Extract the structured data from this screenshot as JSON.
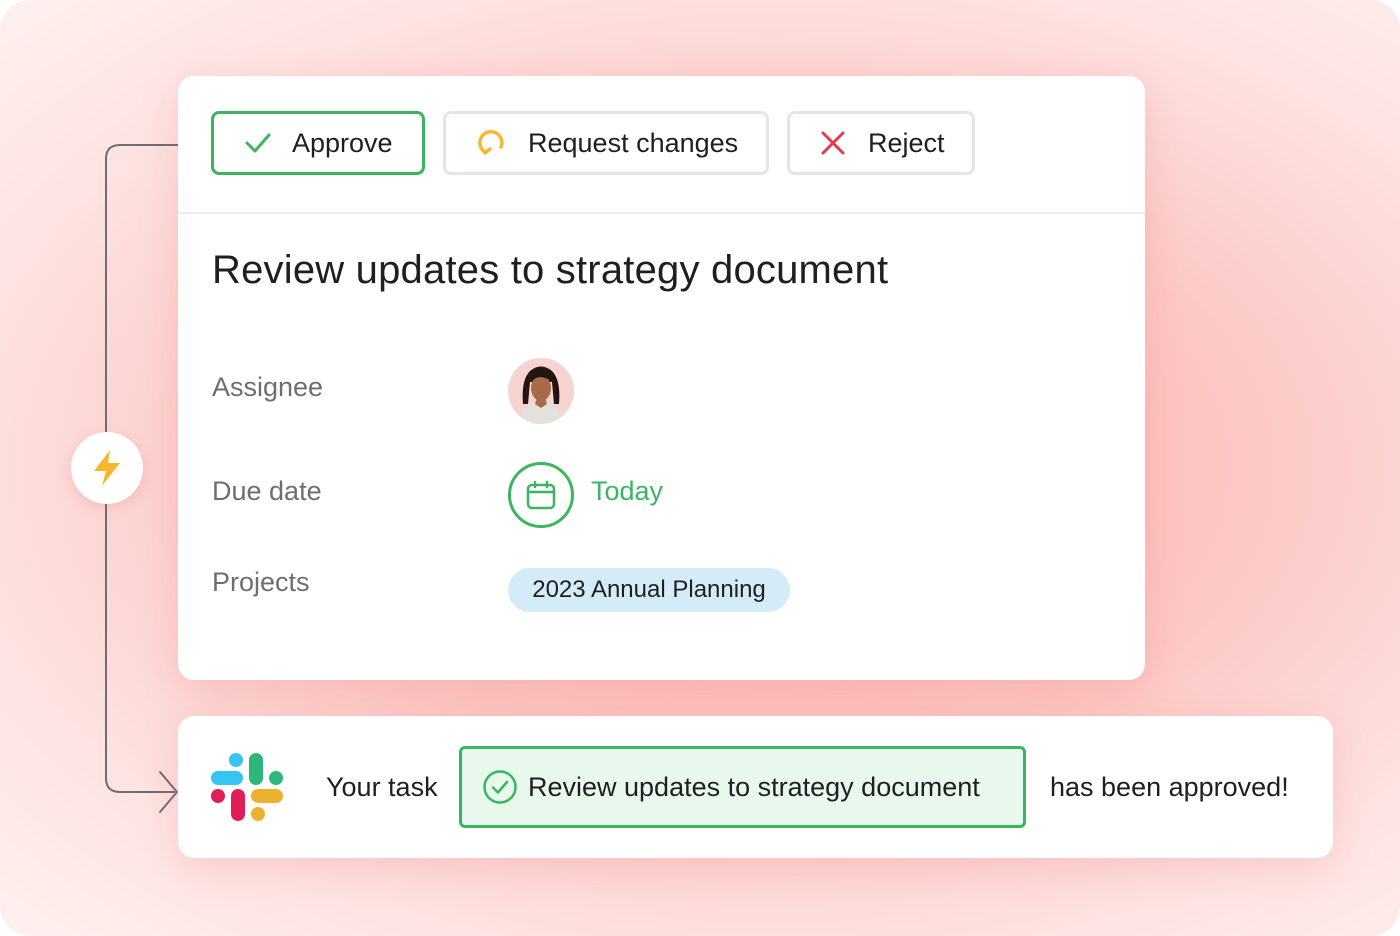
{
  "actions": {
    "approve_label": "Approve",
    "request_changes_label": "Request changes",
    "reject_label": "Reject"
  },
  "task": {
    "title": "Review updates to strategy document",
    "fields": {
      "assignee_label": "Assignee",
      "due_date_label": "Due date",
      "due_date_value": "Today",
      "projects_label": "Projects",
      "project_name": "2023 Annual Planning"
    }
  },
  "notification": {
    "prefix": "Your task",
    "task_name": "Review updates to strategy document",
    "suffix": "has been approved!"
  },
  "icons": {
    "approve": "checkmark-icon",
    "request_changes": "refresh-icon",
    "reject": "close-icon",
    "rule_trigger": "lightning-bolt-icon",
    "due_date": "calendar-icon",
    "notification_app": "slack-logo",
    "completed": "check-circle-icon"
  },
  "colors": {
    "success_green": "#3bb560",
    "warning_yellow": "#f6b72c",
    "danger_red": "#e8384f",
    "project_pill_bg": "#d4ecf7",
    "chip_bg": "#e8f8ec"
  }
}
